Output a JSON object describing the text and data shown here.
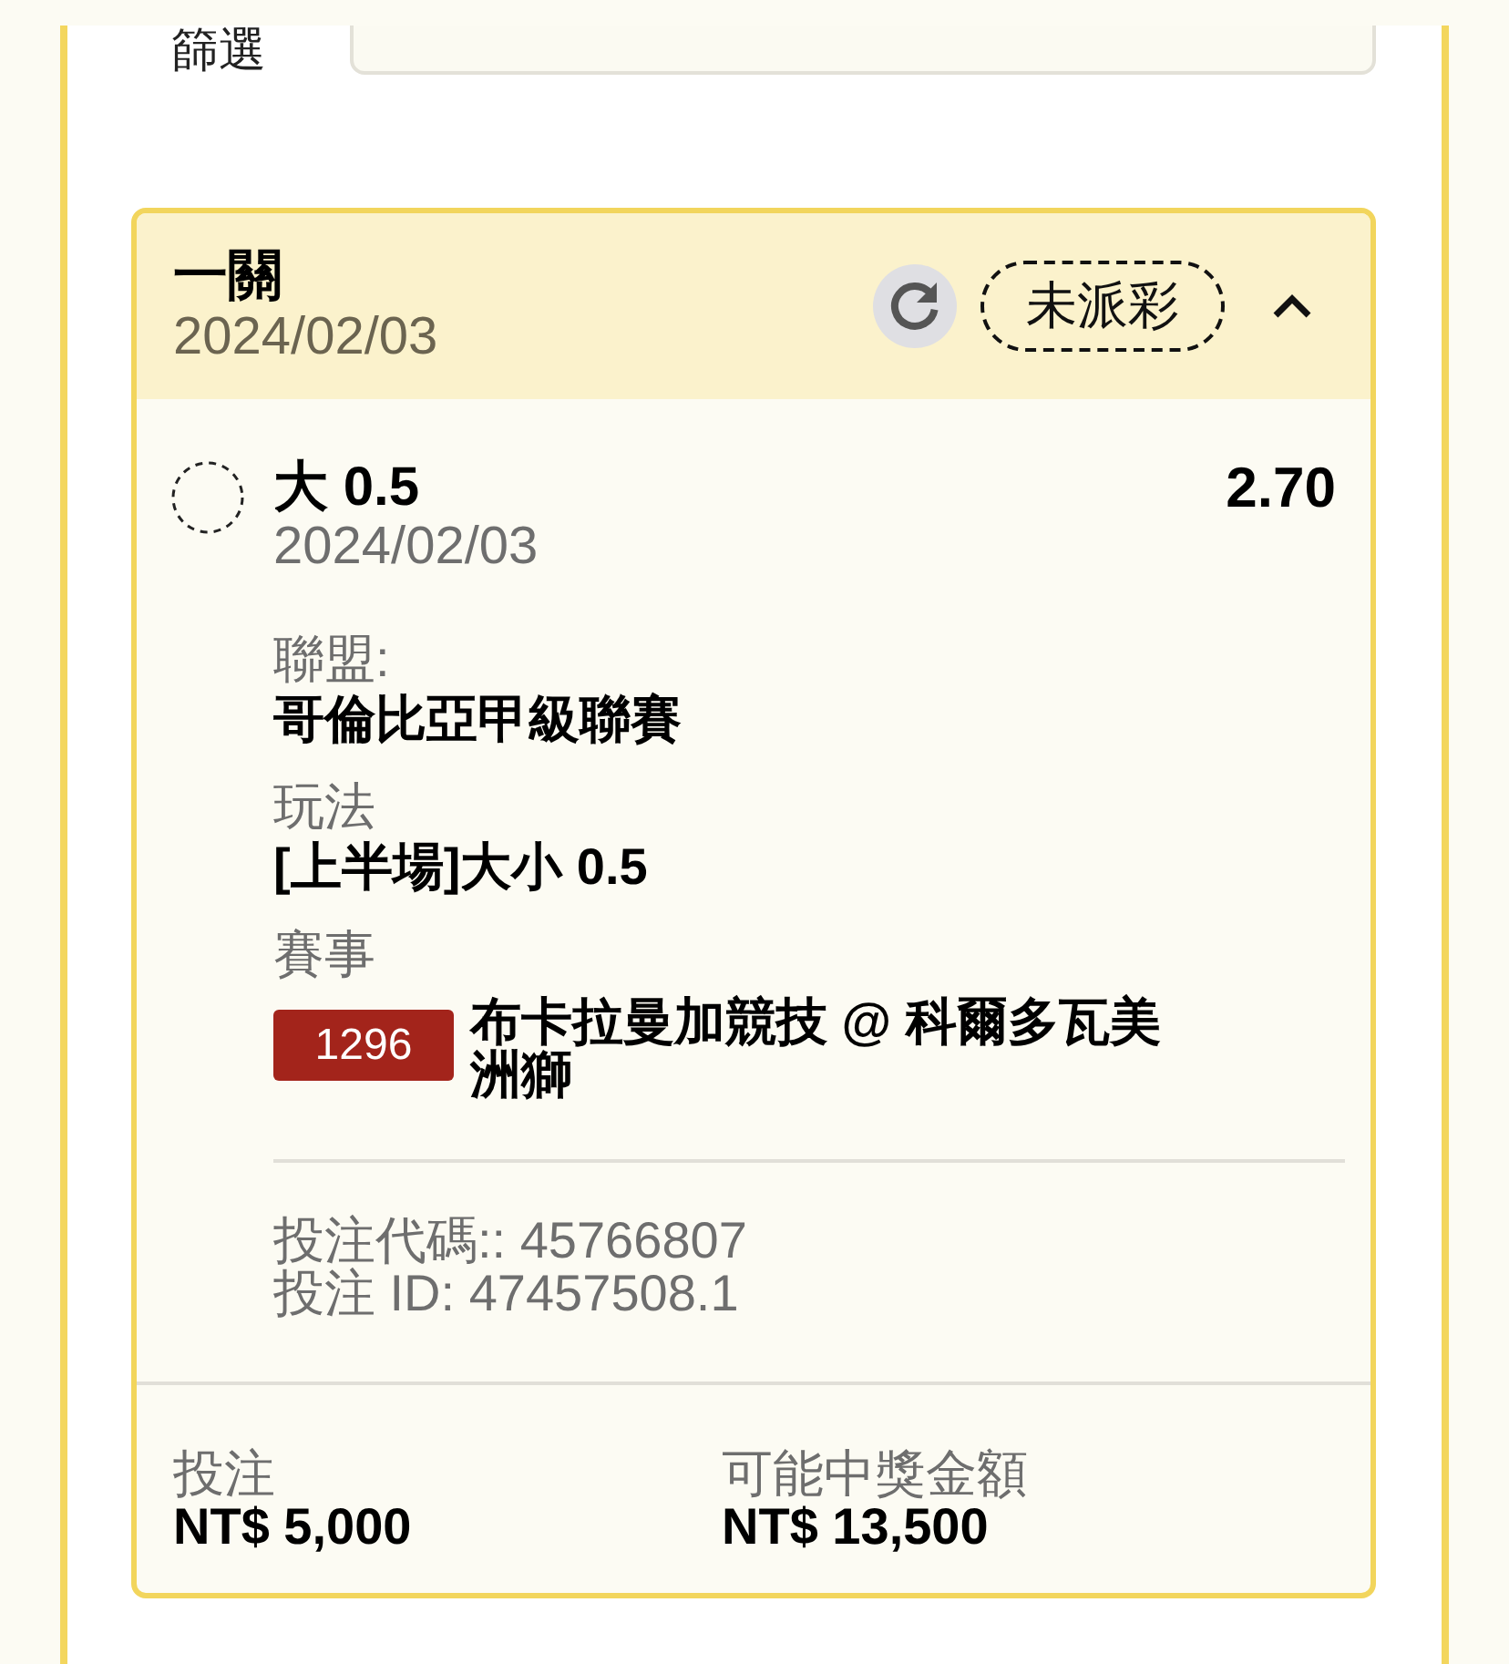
{
  "filter": {
    "label": "篩選"
  },
  "bet_card": {
    "title": "一關",
    "date": "2024/02/03",
    "status": "未派彩",
    "expanded": true,
    "selections": [
      {
        "pick": "大 0.5",
        "odds": "2.70",
        "date": "2024/02/03",
        "details": [
          {
            "label": "聯盟:",
            "value": "哥倫比亞甲級聯賽"
          },
          {
            "label": "玩法",
            "value": "[上半場]大小 0.5"
          }
        ],
        "event": {
          "label": "賽事",
          "match_number": "1296",
          "name": "布卡拉曼加競技 @ 科爾多瓦美洲獅"
        }
      }
    ],
    "codes": [
      "投注代碼:: 45766807",
      "投注 ID: 47457508.1"
    ],
    "summary": [
      {
        "label": "投注",
        "value": "NT$ 5,000"
      },
      {
        "label": "可能中獎金額",
        "value": "NT$ 13,500"
      }
    ]
  }
}
